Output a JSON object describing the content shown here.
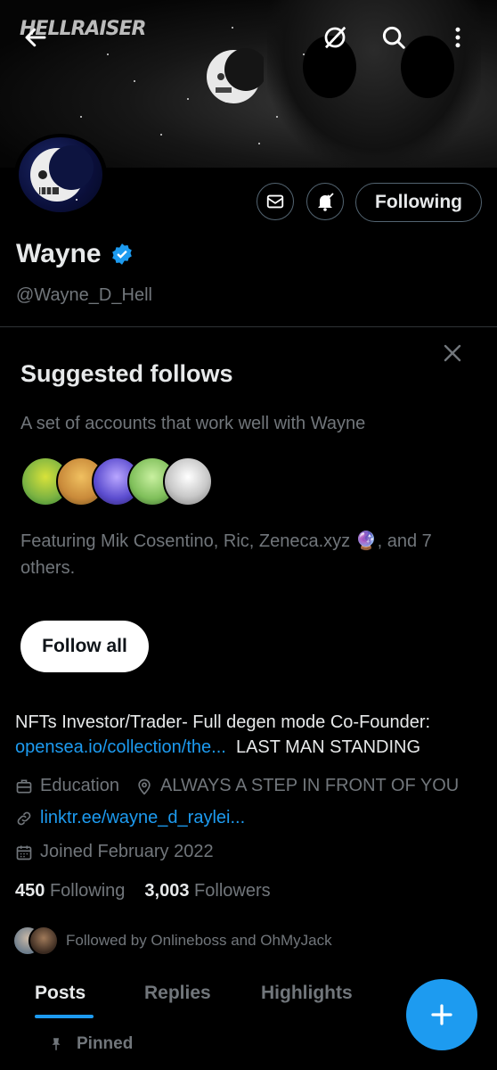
{
  "banner": {
    "brand_text": "HELLRAISER"
  },
  "profile": {
    "name": "Wayne",
    "handle": "@Wayne_D_Hell",
    "following_button": "Following"
  },
  "suggested": {
    "title": "Suggested follows",
    "description": "A set of accounts that work well with Wayne",
    "featuring": "Featuring Mik Cosentino, Ric, Zeneca.xyz 🔮, and 7 others.",
    "follow_all": "Follow all"
  },
  "bio": {
    "text_before": "NFTs Investor/Trader- Full degen mode Co-Founder:",
    "link": "opensea.io/collection/the...",
    "text_after": "LAST MAN STANDING"
  },
  "meta": {
    "category": "Education",
    "location": "ALWAYS A STEP IN FRONT OF YOU",
    "website": "linktr.ee/wayne_d_raylei...",
    "joined": "Joined February 2022"
  },
  "stats": {
    "following_count": "450",
    "following_label": "Following",
    "followers_count": "3,003",
    "followers_label": "Followers"
  },
  "followed_by": "Followed by Onlineboss and OhMyJack",
  "tabs": [
    "Posts",
    "Replies",
    "Highlights"
  ],
  "pinned": "Pinned",
  "colors": {
    "accent": "#1d9bf0",
    "background": "#000000",
    "muted": "#71767b"
  }
}
